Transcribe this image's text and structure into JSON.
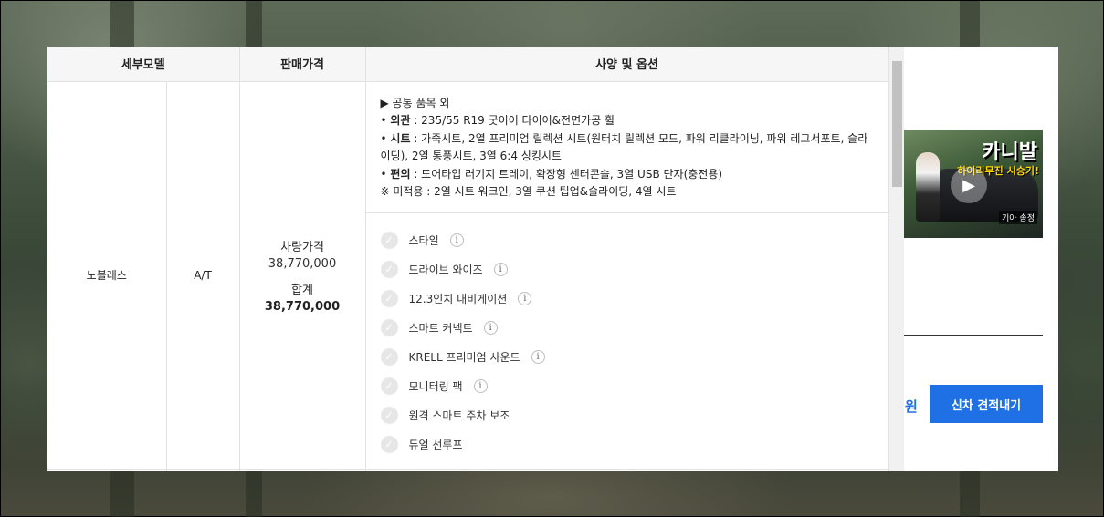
{
  "table": {
    "headers": [
      "세부모델",
      "판매가격",
      "사양 및 옵션"
    ],
    "row": {
      "model": "노블레스",
      "transmission": "A/T",
      "price_label": "차량가격",
      "price_value": "38,770,000",
      "total_label": "합계",
      "total_value": "38,770,000"
    },
    "common": {
      "title": "▶ 공통 품목 외",
      "lines": [
        {
          "key": "외관",
          "text": " : 235/55 R19 굿이어 타이어&전면가공 휠"
        },
        {
          "key": "시트",
          "text": " : 가죽시트, 2열 프리미엄 릴렉션 시트(원터치 릴렉션 모드, 파워 리클라이닝, 파워 레그서포트, 슬라이딩), 2열 통풍시트, 3열 6:4 싱킹시트"
        },
        {
          "key": "편의",
          "text": " : 도어타입 러기지 트레이, 확장형 센터콘솔, 3열 USB 단자(충전용)"
        }
      ],
      "note": "※ 미적용 : 2열 시트 워크인, 3열 쿠션 팁업&슬라이딩, 4열 시트"
    },
    "options": [
      {
        "label": "스타일",
        "info": true
      },
      {
        "label": "드라이브 와이즈",
        "info": true
      },
      {
        "label": "12.3인치 내비게이션",
        "info": true
      },
      {
        "label": "스마트 커넥트",
        "info": true
      },
      {
        "label": "KRELL 프리미엄 사운드",
        "info": true
      },
      {
        "label": "모니터링 팩",
        "info": true
      },
      {
        "label": "원격 스마트 주차 보조",
        "info": false
      },
      {
        "label": "듀얼 선루프",
        "info": false
      }
    ],
    "info_glyph": "i",
    "check_glyph": "✓"
  },
  "sidebar": {
    "thumb_title": "카니발",
    "thumb_sub": "하이리무진 시승기!",
    "thumb_tag": "기아 송정",
    "won": "원",
    "quote_button": "신차 견적내기"
  },
  "colors": {
    "accent": "#1f6fe5"
  }
}
